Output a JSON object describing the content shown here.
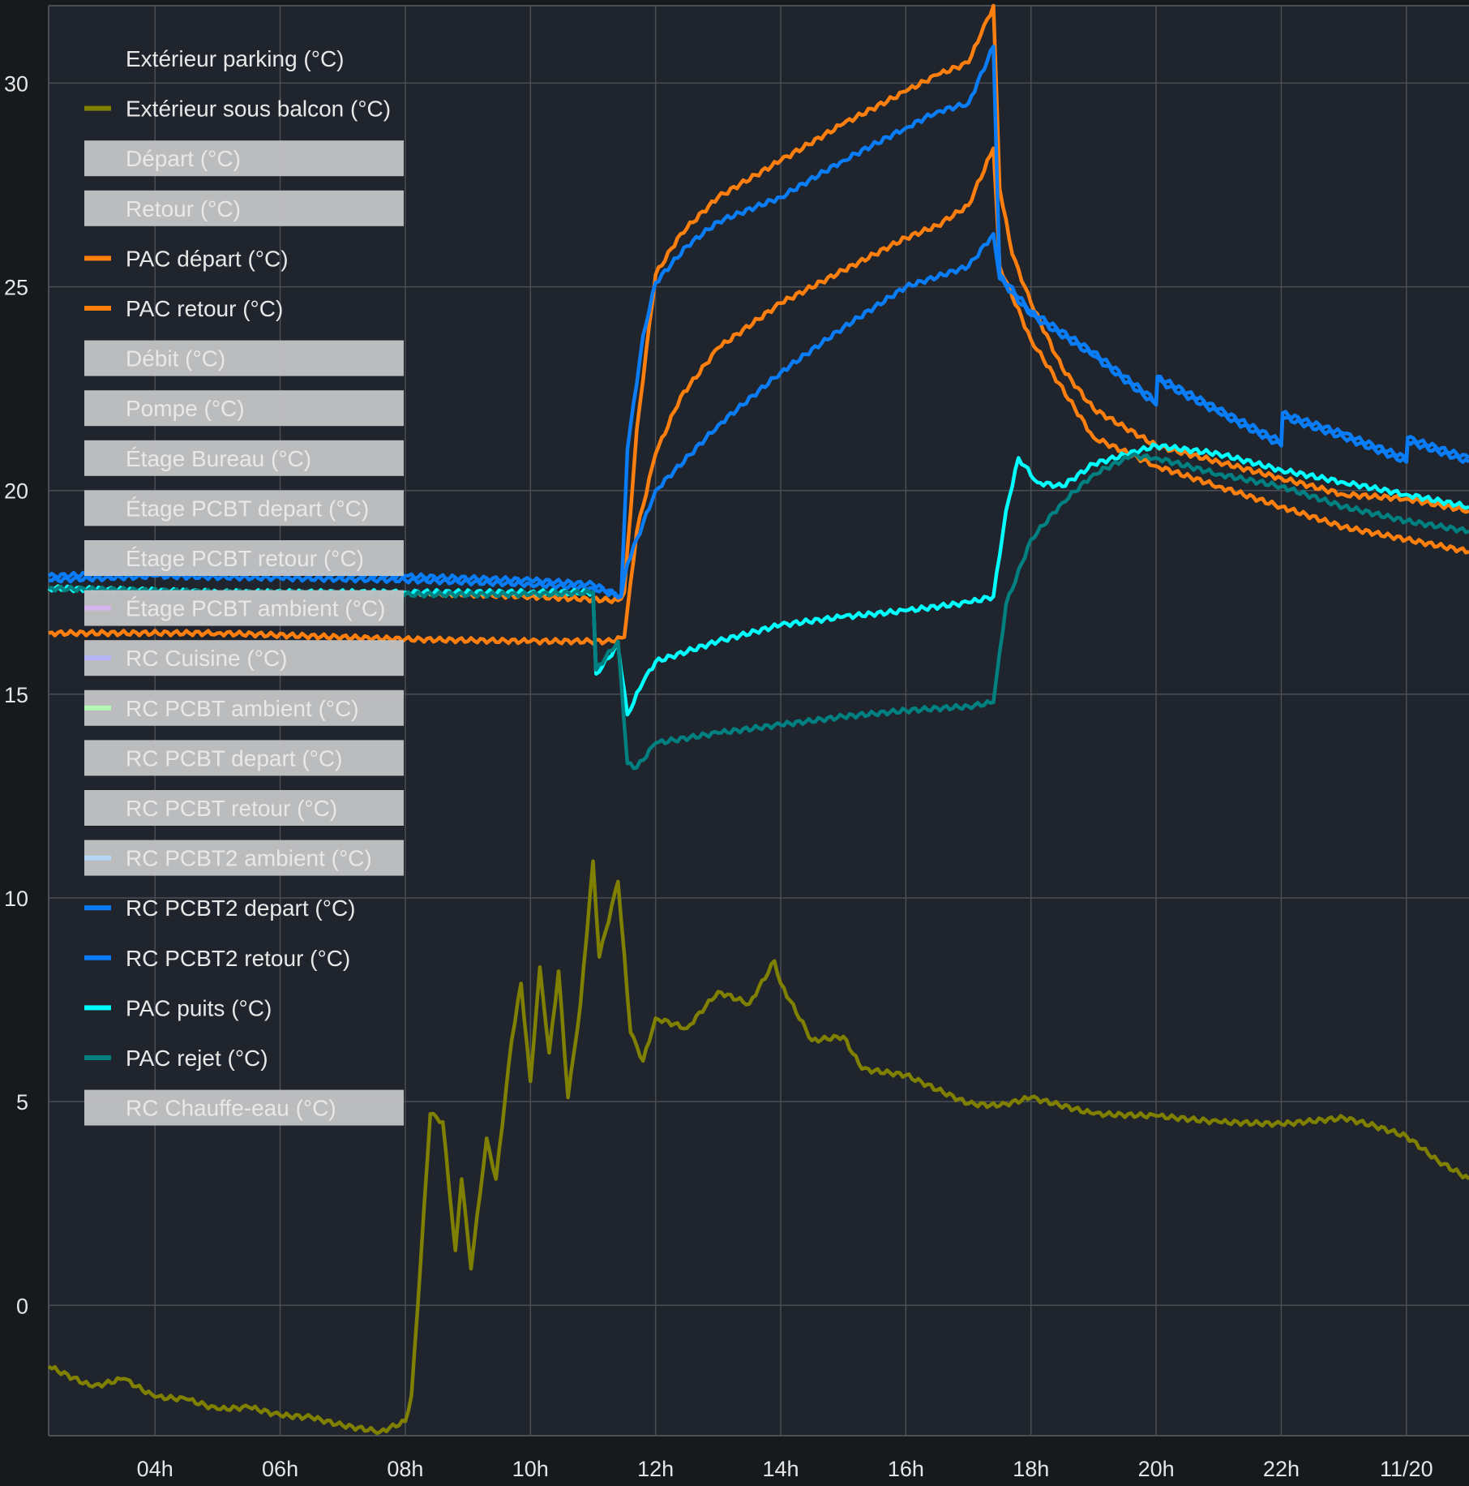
{
  "colors": {
    "background": "#171a1d",
    "plot": "#20242c",
    "grid": "#4a4e55",
    "hidden_box": "#c0c1c3"
  },
  "chart_data": {
    "type": "line",
    "title": "",
    "xlabel": "",
    "ylabel": "",
    "xlim_hours": [
      2.3,
      25.0
    ],
    "ylim": [
      -3.2,
      31.9
    ],
    "grid": true,
    "legend_position": "top-left",
    "x_ticks": [
      {
        "h": 4,
        "label": "04h"
      },
      {
        "h": 6,
        "label": "06h"
      },
      {
        "h": 8,
        "label": "08h"
      },
      {
        "h": 10,
        "label": "10h"
      },
      {
        "h": 12,
        "label": "12h"
      },
      {
        "h": 14,
        "label": "14h"
      },
      {
        "h": 16,
        "label": "16h"
      },
      {
        "h": 18,
        "label": "18h"
      },
      {
        "h": 20,
        "label": "20h"
      },
      {
        "h": 22,
        "label": "22h"
      },
      {
        "h": 24,
        "label": "11/20"
      }
    ],
    "y_ticks": [
      0,
      5,
      10,
      15,
      20,
      25,
      30
    ],
    "legend": [
      {
        "label": "Extérieur parking (°C)",
        "color": "",
        "hidden": false
      },
      {
        "label": "Extérieur sous balcon (°C)",
        "color": "#808000",
        "hidden": false
      },
      {
        "label": "Départ (°C)",
        "color": "",
        "hidden": true
      },
      {
        "label": "Retour (°C)",
        "color": "",
        "hidden": true
      },
      {
        "label": "PAC départ (°C)",
        "color": "#ff7f0e",
        "hidden": false
      },
      {
        "label": "PAC retour (°C)",
        "color": "#ff7f0e",
        "hidden": false
      },
      {
        "label": "Débit (°C)",
        "color": "",
        "hidden": true
      },
      {
        "label": "Pompe (°C)",
        "color": "",
        "hidden": true
      },
      {
        "label": "Étage Bureau (°C)",
        "color": "",
        "hidden": true
      },
      {
        "label": "Étage PCBT depart (°C)",
        "color": "",
        "hidden": true
      },
      {
        "label": "Étage PCBT retour (°C)",
        "color": "",
        "hidden": true
      },
      {
        "label": "Étage PCBT ambient (°C)",
        "color": "#d9b3f5",
        "hidden": true
      },
      {
        "label": "RC Cuisine (°C)",
        "color": "#b3b3ff",
        "hidden": true
      },
      {
        "label": "RC PCBT ambient (°C)",
        "color": "#b3ffb3",
        "hidden": true
      },
      {
        "label": "RC PCBT depart (°C)",
        "color": "",
        "hidden": true
      },
      {
        "label": "RC PCBT retour (°C)",
        "color": "",
        "hidden": true
      },
      {
        "label": "RC PCBT2 ambient (°C)",
        "color": "#b3d9ff",
        "hidden": true
      },
      {
        "label": "RC PCBT2 depart (°C)",
        "color": "#0a7cf5",
        "hidden": false
      },
      {
        "label": "RC PCBT2 retour (°C)",
        "color": "#0a7cf5",
        "hidden": false
      },
      {
        "label": "PAC puits (°C)",
        "color": "#00ffff",
        "hidden": false
      },
      {
        "label": "PAC rejet (°C)",
        "color": "#008080",
        "hidden": false
      },
      {
        "label": "RC Chauffe-eau (°C)",
        "color": "",
        "hidden": true
      }
    ],
    "series": [
      {
        "name": "Extérieur sous balcon (°C)",
        "color": "#808000",
        "x": [
          2.3,
          3,
          3.5,
          4,
          4.5,
          5,
          5.5,
          6,
          6.5,
          7,
          7.6,
          8,
          8.1,
          8.2,
          8.4,
          8.6,
          8.8,
          8.9,
          9.05,
          9.3,
          9.45,
          9.7,
          9.85,
          10,
          10.15,
          10.3,
          10.45,
          10.6,
          10.8,
          11.0,
          11.1,
          11.4,
          11.6,
          11.8,
          12,
          12.5,
          13,
          13.5,
          13.9,
          14,
          14.5,
          15,
          15.3,
          16,
          17,
          17.5,
          18,
          19,
          20,
          21,
          22,
          23,
          23.5,
          24,
          24.5,
          25
        ],
        "y": [
          -1.5,
          -2.0,
          -1.8,
          -2.25,
          -2.3,
          -2.55,
          -2.5,
          -2.7,
          -2.75,
          -2.95,
          -3.1,
          -2.85,
          -2.2,
          0,
          4.7,
          4.5,
          1.35,
          3.1,
          0.9,
          4.1,
          3.1,
          6.5,
          7.9,
          5.5,
          8.3,
          6.2,
          8.2,
          5.1,
          7.4,
          10.9,
          8.55,
          10.4,
          6.7,
          6.0,
          7.05,
          6.8,
          7.7,
          7.4,
          8.45,
          7.9,
          6.5,
          6.6,
          5.8,
          5.65,
          4.95,
          4.9,
          5.1,
          4.7,
          4.65,
          4.5,
          4.45,
          4.6,
          4.4,
          4.15,
          3.55,
          3.1
        ]
      },
      {
        "name": "PAC départ (°C)",
        "color": "#ff7f0e",
        "x": [
          2.3,
          5,
          8,
          10,
          11.4,
          11.5,
          11.7,
          12,
          12.4,
          13,
          14,
          15,
          16,
          16.5,
          17,
          17.2,
          17.4,
          17.5,
          17.7,
          18,
          18.5,
          19,
          20,
          21,
          22,
          23,
          24,
          25
        ],
        "y": [
          17.6,
          17.5,
          17.5,
          17.4,
          17.3,
          17.5,
          21.5,
          25.3,
          26.3,
          27.2,
          28.1,
          29.0,
          29.8,
          30.2,
          30.5,
          31.2,
          31.9,
          27.4,
          25.8,
          24.6,
          23.0,
          22.0,
          21.1,
          20.7,
          20.3,
          19.9,
          19.8,
          19.5
        ]
      },
      {
        "name": "PAC retour (°C)",
        "color": "#ff7f0e",
        "x": [
          2.3,
          5,
          8,
          10,
          11.3,
          11.5,
          11.7,
          12,
          12.4,
          13,
          14,
          15,
          16,
          16.5,
          17,
          17.4,
          17.5,
          18,
          19,
          20,
          21,
          22,
          23,
          24,
          25
        ],
        "y": [
          16.5,
          16.5,
          16.35,
          16.3,
          16.3,
          16.4,
          19.0,
          20.9,
          22.3,
          23.5,
          24.6,
          25.4,
          26.2,
          26.5,
          27.0,
          28.4,
          25.5,
          23.7,
          21.3,
          20.6,
          20.1,
          19.6,
          19.1,
          18.8,
          18.5
        ]
      },
      {
        "name": "RC PCBT2 depart (°C)",
        "color": "#0a7cf5",
        "x": [
          2.3,
          4,
          6,
          8,
          10,
          11.0,
          11.45,
          11.55,
          11.8,
          12,
          12.5,
          13,
          14,
          15,
          16,
          16.5,
          17,
          17.4,
          17.5,
          18,
          19,
          20,
          20.02,
          21,
          22,
          22.02,
          23,
          24,
          24.02,
          25
        ],
        "y": [
          17.9,
          18.0,
          18.0,
          17.9,
          17.8,
          17.7,
          17.4,
          21.0,
          23.8,
          25.1,
          26.0,
          26.6,
          27.2,
          28.1,
          28.9,
          29.3,
          29.5,
          30.9,
          25.3,
          24.4,
          23.4,
          22.2,
          22.8,
          22.0,
          21.2,
          21.9,
          21.4,
          20.8,
          21.3,
          20.8
        ]
      },
      {
        "name": "RC PCBT2 retour (°C)",
        "color": "#0a7cf5",
        "x": [
          2.3,
          4,
          6,
          8,
          10,
          11.0,
          11.45,
          11.55,
          11.8,
          12,
          13,
          14,
          15,
          16,
          17,
          17.4,
          17.5,
          18,
          19,
          20,
          20.02,
          21,
          22,
          22.02,
          23,
          24,
          24.02,
          25
        ],
        "y": [
          17.8,
          17.9,
          17.85,
          17.8,
          17.7,
          17.6,
          17.4,
          18.2,
          19.2,
          20.0,
          21.6,
          22.9,
          24.0,
          25.0,
          25.5,
          26.3,
          25.2,
          24.3,
          23.3,
          22.1,
          22.7,
          21.9,
          21.1,
          21.8,
          21.3,
          20.7,
          21.2,
          20.7
        ]
      },
      {
        "name": "PAC puits (°C)",
        "color": "#00ffff",
        "x": [
          2.3,
          5,
          8,
          10,
          11.0,
          11.05,
          11.4,
          11.55,
          11.8,
          12,
          13,
          14,
          15,
          16,
          17,
          17.4,
          17.6,
          17.8,
          18.1,
          18.5,
          19,
          20,
          21,
          22,
          23,
          24,
          25
        ],
        "y": [
          17.6,
          17.5,
          17.5,
          17.5,
          17.5,
          15.5,
          16.2,
          14.5,
          15.3,
          15.8,
          16.3,
          16.7,
          16.9,
          17.05,
          17.25,
          17.4,
          19.5,
          20.8,
          20.2,
          20.1,
          20.65,
          21.1,
          20.9,
          20.5,
          20.2,
          19.9,
          19.6
        ]
      },
      {
        "name": "PAC rejet (°C)",
        "color": "#008080",
        "x": [
          2.3,
          5,
          8,
          10,
          11.0,
          11.05,
          11.4,
          11.55,
          11.7,
          12,
          13,
          14,
          15,
          16,
          17,
          17.4,
          17.6,
          18,
          18.5,
          19,
          19.6,
          20,
          21,
          22,
          23,
          24,
          25
        ],
        "y": [
          17.6,
          17.5,
          17.45,
          17.45,
          17.5,
          15.6,
          16.3,
          13.3,
          13.2,
          13.8,
          14.05,
          14.25,
          14.45,
          14.6,
          14.7,
          14.8,
          17.2,
          18.8,
          19.7,
          20.4,
          20.85,
          20.8,
          20.4,
          20.1,
          19.6,
          19.25,
          19.0
        ]
      }
    ]
  }
}
